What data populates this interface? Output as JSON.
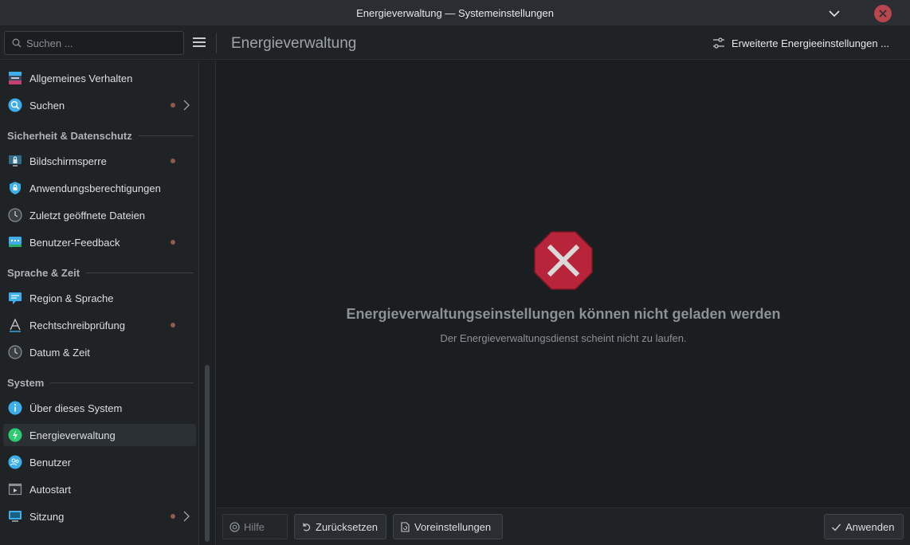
{
  "window": {
    "title": "Energieverwaltung — Systemeinstellungen"
  },
  "header": {
    "search_placeholder": "Suchen ...",
    "page_title": "Energieverwaltung",
    "advanced_button": "Erweiterte Energieeinstellungen ..."
  },
  "sidebar": {
    "items_top": [
      {
        "label": "Allgemeines Verhalten",
        "icon": "general-behavior-icon"
      },
      {
        "label": "Suchen",
        "icon": "search-icon",
        "dot": true,
        "chevron": true
      }
    ],
    "sections": [
      {
        "title": "Sicherheit & Datenschutz",
        "items": [
          {
            "label": "Bildschirmsperre",
            "icon": "screen-lock-icon",
            "dot": true
          },
          {
            "label": "Anwendungsberechtigungen",
            "icon": "shield-icon"
          },
          {
            "label": "Zuletzt geöffnete Dateien",
            "icon": "clock-icon"
          },
          {
            "label": "Benutzer-Feedback",
            "icon": "feedback-icon",
            "dot": true
          }
        ]
      },
      {
        "title": "Sprache & Zeit",
        "items": [
          {
            "label": "Region & Sprache",
            "icon": "region-icon"
          },
          {
            "label": "Rechtschreibprüfung",
            "icon": "spellcheck-icon",
            "dot": true
          },
          {
            "label": "Datum & Zeit",
            "icon": "clock-icon"
          }
        ]
      },
      {
        "title": "System",
        "items": [
          {
            "label": "Über dieses System",
            "icon": "info-icon"
          },
          {
            "label": "Energieverwaltung",
            "icon": "power-icon",
            "active": true
          },
          {
            "label": "Benutzer",
            "icon": "users-icon"
          },
          {
            "label": "Autostart",
            "icon": "autostart-icon"
          },
          {
            "label": "Sitzung",
            "icon": "session-icon",
            "dot": true,
            "chevron": true
          }
        ]
      }
    ]
  },
  "main": {
    "error_title": "Energieverwaltungseinstellungen können nicht geladen werden",
    "error_message": "Der Energieverwaltungsdienst scheint nicht zu laufen."
  },
  "footer": {
    "help": "Hilfe",
    "reset": "Zurücksetzen",
    "defaults": "Voreinstellungen",
    "apply": "Anwenden"
  },
  "colors": {
    "accent": "#3daee9",
    "error": "#c8283a",
    "modified_dot": "#8e5a4c"
  }
}
